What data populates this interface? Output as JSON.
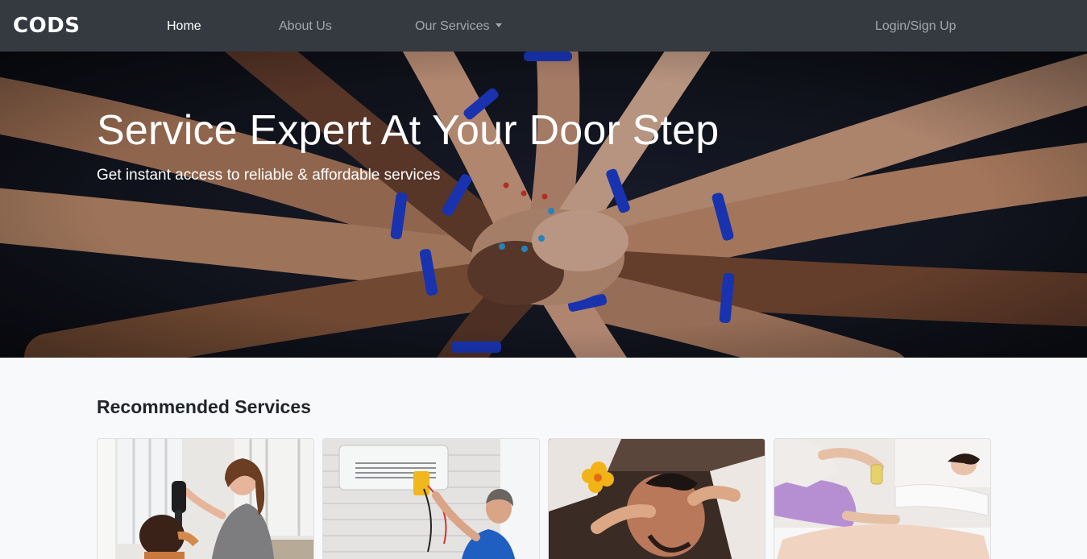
{
  "navbar": {
    "brand": "CODS",
    "links": [
      {
        "label": "Home"
      },
      {
        "label": "About Us"
      },
      {
        "label": "Our Services"
      },
      {
        "label": "Login/Sign Up"
      }
    ]
  },
  "hero": {
    "title": "Service Expert At Your Door Step",
    "subtitle": "Get instant access to reliable & affordable services",
    "image_description": "hands-stacked-photo"
  },
  "recommended": {
    "title": "Recommended Services",
    "cards": [
      {
        "image": "hair-salon-photo"
      },
      {
        "image": "ac-repair-photo"
      },
      {
        "image": "face-massage-photo"
      },
      {
        "image": "body-massage-photo"
      }
    ]
  },
  "colors": {
    "navbar": "#343a40",
    "page_background": "#f8f9fa",
    "wristband_blue": "#1f3fd6"
  }
}
